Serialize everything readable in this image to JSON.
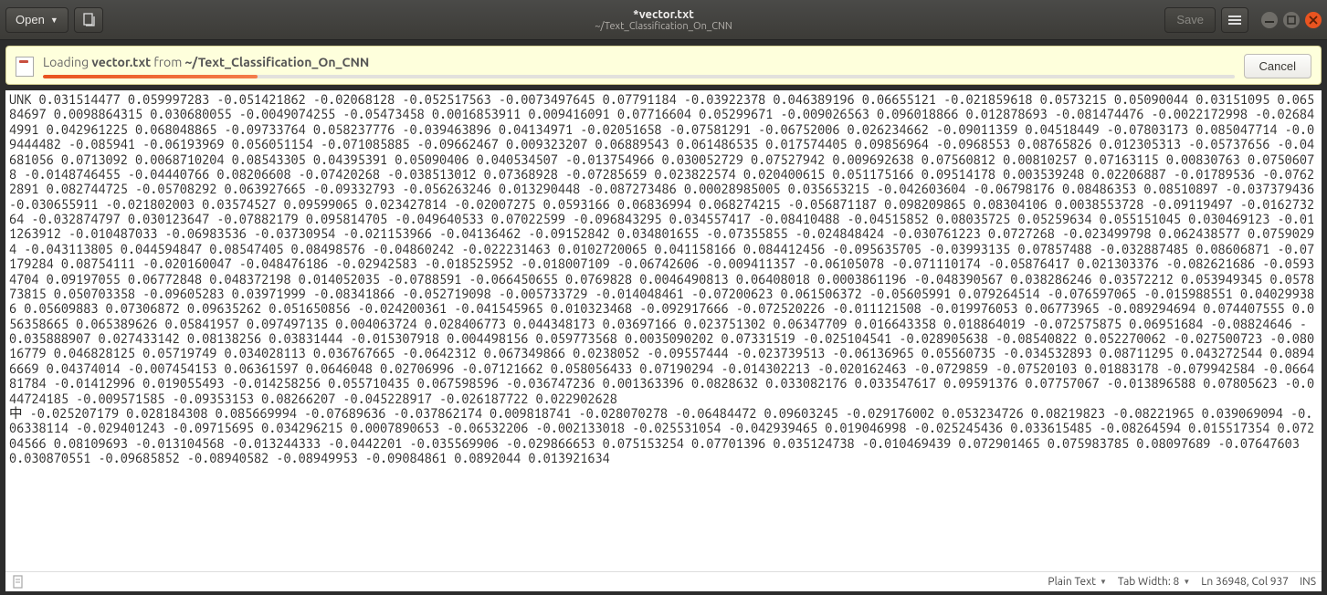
{
  "titlebar": {
    "open_label": "Open",
    "title": "*vector.txt",
    "subtitle": "~/Text_Classification_On_CNN",
    "save_label": "Save"
  },
  "infobar": {
    "loading_prefix": "Loading ",
    "file_name": "vector.txt",
    "loading_middle": " from ",
    "path": "~/Text_Classification_On_CNN",
    "cancel_label": "Cancel",
    "progress_pct": 18
  },
  "content": {
    "text": "UNK 0.031514477 0.059997283 -0.051421862 -0.02068128 -0.052517563 -0.0073497645 0.07791184 -0.03922378 0.046389196 0.06655121 -0.021859618 0.0573215 0.05090044 0.03151095 0.06584697 0.0098864315 0.030680055 -0.0049074255 -0.05473458 0.0016853911 0.009416091 0.07716604 0.05299671 -0.009026563 0.096018866 0.012878693 -0.081474476 -0.0022172998 -0.026844991 0.042961225 0.068048865 -0.09733764 0.058237776 -0.039463896 0.04134971 -0.02051658 -0.07581291 -0.06752006 0.026234662 -0.09011359 0.04518449 -0.07803173 0.085047714 -0.09444482 -0.085941 -0.06193969 0.056051154 -0.071085885 -0.09662467 0.009323207 0.06889543 0.061486535 0.017574405 0.09856964 -0.0968553 0.08765826 0.012305313 -0.05737656 -0.04681056 0.0713092 0.0068710204 0.08543305 0.04395391 0.05090406 0.040534507 -0.013754966 0.030052729 0.07527942 0.009692638 0.07560812 0.00810257 0.07163115 0.00830763 0.07506078 -0.0148746455 -0.04440766 0.08206608 -0.07420268 -0.038513012 0.07368928 -0.07285659 0.023822574 0.020400615 0.051175166 0.09514178 0.003539248 0.02206887 -0.01789536 -0.07622891 0.082744725 -0.05708292 0.063927665 -0.09332793 -0.056263246 0.013290448 -0.087273486 0.00028985005 0.035653215 -0.042603604 -0.06798176 0.08486353 0.08510897 -0.037379436 -0.030655911 -0.021802003 0.03574527 0.09599065 0.023427814 -0.02007275 0.0593166 0.06836994 0.068274215 -0.056871187 0.098209865 0.08304106 0.0038553728 -0.09119497 -0.016273264 -0.032874797 0.030123647 -0.07882179 0.095814705 -0.049640533 0.07022599 -0.096843295 0.034557417 -0.08410488 -0.04515852 0.08035725 0.05259634 0.055151045 0.030469123 -0.011263912 -0.010487033 -0.06983536 -0.03730954 -0.021153966 -0.04136462 -0.09152842 0.034801655 -0.07355855 -0.024848424 -0.030761223 0.0727268 -0.023499798 0.062438577 0.07590294 -0.043113805 0.044594847 0.08547405 0.08498576 -0.04860242 -0.022231463 0.0102720065 0.041158166 0.084412456 -0.095635705 -0.03993135 0.07857488 -0.032887485 0.08606871 -0.07179284 0.08754111 -0.020160047 -0.048476186 -0.02942583 -0.018525952 -0.018007109 -0.06742606 -0.009411357 -0.06105078 -0.071110174 -0.05876417 0.021303376 -0.082621686 -0.05934704 0.09197055 0.06772848 0.048372198 0.014052035 -0.0788591 -0.066450655 0.0769828 0.0046490813 0.06408018 0.0003861196 -0.048390567 0.038286246 0.03572212 0.053949345 0.057873815 0.050703358 -0.09605283 0.03971999 -0.08341866 -0.052719098 -0.005733729 -0.014048461 -0.07200623 0.061506372 -0.05605991 0.079264514 -0.076597065 -0.015988551 0.040299386 0.05609883 0.07306872 0.09635262 0.051650856 -0.024200361 -0.041545965 0.010323468 -0.092917666 -0.072520226 -0.011121508 -0.019976053 0.06773965 -0.089294694 0.074407555 0.056358665 0.065389626 0.05841957 0.097497135 0.004063724 0.028406773 0.044348173 0.03697166 0.023751302 0.06347709 0.016643358 0.018864019 -0.072575875 0.06951684 -0.08824646 -0.035888907 0.027433142 0.08138256 0.03831444 -0.015307918 0.004498156 0.059773568 0.0035090202 0.07331519 -0.025104541 -0.028905638 -0.08540822 0.052270062 -0.027500723 -0.08016779 0.046828125 0.05719749 0.034028113 0.036767665 -0.0642312 0.067349866 0.0238052 -0.09557444 -0.023739513 -0.06136965 0.05560735 -0.034532893 0.08711295 0.043272544 0.08946669 0.04374014 -0.007454153 0.06361597 0.0646048 0.02706996 -0.07121662 0.058056433 0.07190294 -0.014302213 -0.020162463 -0.0729859 -0.07520103 0.01883178 -0.079942584 -0.066481784 -0.01412996 0.019055493 -0.014258256 0.055710435 0.067598596 -0.036747236 0.001363396 0.0828632 0.033082176 0.033547617 0.09591376 0.07757067 -0.013896588 0.07805623 -0.044724185 -0.009571585 -0.09353153 0.08266207 -0.045228917 -0.026187722 0.022902628\n中 -0.025207179 0.028184308 0.085669994 -0.07689636 -0.037862174 0.009818741 -0.028070278 -0.06484472 0.09603245 -0.029176002 0.053234726 0.08219823 -0.08221965 0.039069094 -0.06338114 -0.029401243 -0.09715695 0.034296215 0.0007890653 -0.06532206 -0.002133018 -0.025531054 -0.042939465 0.019046998 -0.025245436 0.033615485 -0.08264594 0.015517354 0.07204566 0.08109693 -0.013104568 -0.013244333 -0.0442201 -0.035569906 -0.029866653 0.075153254 0.07701396 0.035124738 -0.010469439 0.072901465 0.075983785 0.08097689 -0.07647603 0.030870551 -0.09685852 -0.08940582 -0.08949953 -0.09084861 0.0892044 0.013921634"
  },
  "statusbar": {
    "language": "Plain Text",
    "tab_width_label": "Tab Width: 8",
    "position": "Ln 36948, Col 937",
    "insert_mode": "INS"
  }
}
